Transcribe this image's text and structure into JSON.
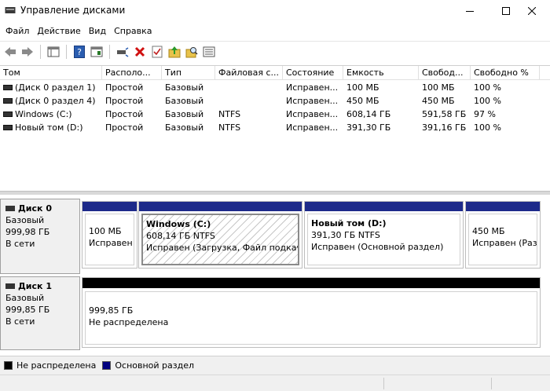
{
  "window": {
    "title": "Управление дисками"
  },
  "menu": [
    "Файл",
    "Действие",
    "Вид",
    "Справка"
  ],
  "toolbar": {
    "buttons": [
      "back-icon",
      "forward-icon",
      "show-tree-icon",
      "help-icon",
      "properties-icon",
      "connect-icon",
      "delete-icon",
      "check-icon",
      "up-folder-icon",
      "search-folder-icon",
      "list-view-icon"
    ]
  },
  "volume_list": {
    "columns": [
      "Том",
      "Располо...",
      "Тип",
      "Файловая с...",
      "Состояние",
      "Емкость",
      "Свобод...",
      "Свободно %"
    ],
    "rows": [
      [
        "(Диск 0 раздел 1)",
        "Простой",
        "Базовый",
        "",
        "Исправен...",
        "100 МБ",
        "100 МБ",
        "100 %"
      ],
      [
        "(Диск 0 раздел 4)",
        "Простой",
        "Базовый",
        "",
        "Исправен...",
        "450 МБ",
        "450 МБ",
        "100 %"
      ],
      [
        "Windows (C:)",
        "Простой",
        "Базовый",
        "NTFS",
        "Исправен...",
        "608,14 ГБ",
        "591,58 ГБ",
        "97 %"
      ],
      [
        "Новый том (D:)",
        "Простой",
        "Базовый",
        "NTFS",
        "Исправен...",
        "391,30 ГБ",
        "391,16 ГБ",
        "100 %"
      ]
    ]
  },
  "disks": [
    {
      "name": "Диск 0",
      "type": "Базовый",
      "size": "999,98 ГБ",
      "state": "В сети",
      "partitions": [
        {
          "title": "",
          "line1": "100 МБ",
          "line2": "Исправен"
        },
        {
          "title": "Windows  (C:)",
          "line1": "608,14 ГБ NTFS",
          "line2": "Исправен (Загрузка, Файл подкачки"
        },
        {
          "title": "Новый том  (D:)",
          "line1": "391,30 ГБ NTFS",
          "line2": "Исправен (Основной раздел)"
        },
        {
          "title": "",
          "line1": "450 МБ",
          "line2": "Исправен (Раз"
        }
      ]
    },
    {
      "name": "Диск 1",
      "type": "Базовый",
      "size": "999,85 ГБ",
      "state": "В сети",
      "partitions": [
        {
          "title": "",
          "line1": "999,85 ГБ",
          "line2": "Не распределена"
        }
      ]
    }
  ],
  "legend": [
    {
      "label": "Не распределена",
      "color": "#000000"
    },
    {
      "label": "Основной раздел",
      "color": "#000080"
    }
  ],
  "colors": {
    "primary_partition": "#1d2a8a",
    "unallocated": "#000000"
  }
}
